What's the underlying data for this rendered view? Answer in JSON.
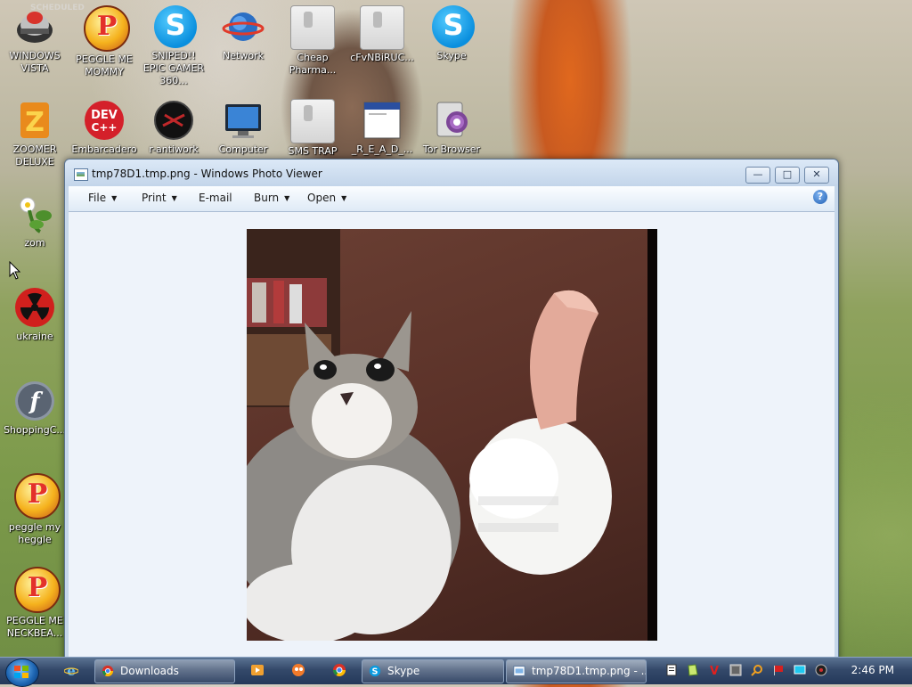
{
  "desktop": {
    "icons": [
      {
        "label": "WINDOWS VISTA"
      },
      {
        "label": "PEGGLE ME MOMMY"
      },
      {
        "label": "SNIPED!! EPIC GAMER 360..."
      },
      {
        "label": "Network"
      },
      {
        "label": "Cheap Pharma..."
      },
      {
        "label": "cFvNBiRUC..."
      },
      {
        "label": "Skype"
      },
      {
        "label": "ZOOMER DELUXE"
      },
      {
        "label": "Embarcadero"
      },
      {
        "label": "r-antiwork"
      },
      {
        "label": "Computer"
      },
      {
        "label": "SMS TRAP"
      },
      {
        "label": "_R_E_A_D_..."
      },
      {
        "label": "Tor Browser"
      },
      {
        "label": "zom"
      },
      {
        "label": "ukraine"
      },
      {
        "label": "ShoppingC..."
      },
      {
        "label": "peggle my heggle"
      },
      {
        "label": "PEGGLE ME NECKBEA..."
      }
    ],
    "wallpaper_text": "SCHEDULED"
  },
  "window": {
    "title": "tmp78D1.tmp.png - Windows Photo Viewer",
    "menus": [
      "File",
      "Print",
      "E-mail",
      "Burn",
      "Open"
    ],
    "help": "?",
    "image_description_icon": "cat-thumbs-up-photo"
  },
  "taskbar": {
    "tasks": [
      {
        "label": "Downloads"
      },
      {
        "label": "Skype"
      },
      {
        "label": "tmp78D1.tmp.png - ..."
      }
    ],
    "clock": "2:46 PM"
  }
}
